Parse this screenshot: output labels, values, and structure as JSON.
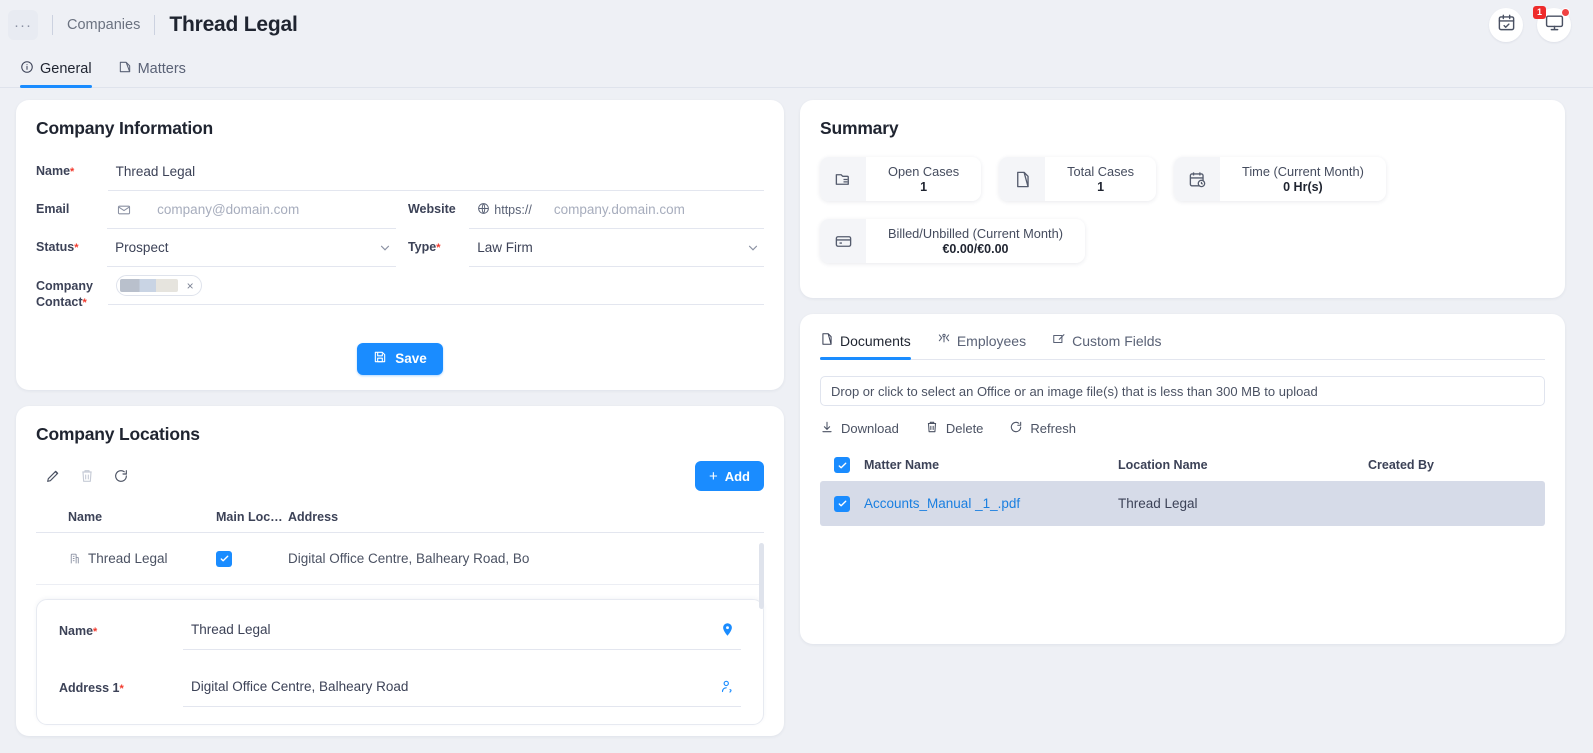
{
  "topbar": {
    "overflow_label": "···",
    "breadcrumb": "Companies",
    "title": "Thread Legal",
    "calendar_icon": "calendar-check-icon",
    "notification_icon": "monitor-notification-icon",
    "notification_count": "1"
  },
  "tabs": [
    {
      "label": "General",
      "icon": "info-circle-icon",
      "active": true
    },
    {
      "label": "Matters",
      "icon": "matters-icon",
      "active": false
    }
  ],
  "company_information": {
    "title": "Company Information",
    "fields": {
      "name": {
        "label": "Name",
        "required": true,
        "value": "Thread Legal"
      },
      "email": {
        "label": "Email",
        "required": false,
        "placeholder": "company@domain.com",
        "value": "",
        "icon": "envelope-icon"
      },
      "website": {
        "label": "Website",
        "required": false,
        "prefix": "https://",
        "placeholder": "company.domain.com",
        "value": "",
        "icon": "globe-icon"
      },
      "status": {
        "label": "Status",
        "required": true,
        "value": "Prospect"
      },
      "type": {
        "label": "Type",
        "required": true,
        "value": "Law Firm"
      },
      "company_contact": {
        "label": "Company Contact",
        "required": true,
        "chip_value": "",
        "chip_remove": "×"
      }
    },
    "save_label": "Save",
    "save_icon": "floppy-save-icon",
    "save_color": "#1a8cff"
  },
  "summary": {
    "title": "Summary",
    "stats": [
      {
        "label": "Open Cases",
        "value": "1",
        "icon": "folder-list-icon"
      },
      {
        "label": "Total Cases",
        "value": "1",
        "icon": "document-fold-icon"
      },
      {
        "label": "Time (Current Month)",
        "value": "0 Hr(s)",
        "icon": "calendar-clock-icon"
      },
      {
        "label": "Billed/Unbilled (Current Month)",
        "value": "€0.00/€0.00",
        "icon": "wallet-icon"
      }
    ]
  },
  "company_locations": {
    "title": "Company Locations",
    "toolbar": [
      {
        "name": "edit",
        "icon": "pencil-icon",
        "disabled": false
      },
      {
        "name": "delete",
        "icon": "trash-icon",
        "disabled": true
      },
      {
        "name": "refresh",
        "icon": "refresh-icon",
        "disabled": false
      }
    ],
    "add_label": "Add",
    "columns": [
      "Name",
      "Main Loc…",
      "Address"
    ],
    "rows": [
      {
        "name": "Thread Legal",
        "name_icon": "building-icon",
        "main_location": true,
        "address": "Digital Office Centre, Balheary Road, Bo"
      }
    ],
    "edit_form": {
      "name": {
        "label": "Name",
        "required": true,
        "value": "Thread Legal",
        "icon": "map-pin-icon"
      },
      "address1": {
        "label": "Address 1",
        "required": true,
        "value": "Digital Office Centre, Balheary Road",
        "icon": "person-search-icon"
      }
    }
  },
  "documents_panel": {
    "tabs": [
      {
        "label": "Documents",
        "icon": "document-fold-icon",
        "active": true
      },
      {
        "label": "Employees",
        "icon": "employees-icon",
        "active": false
      },
      {
        "label": "Custom Fields",
        "icon": "custom-fields-icon",
        "active": false
      }
    ],
    "dropzone_text": "Drop or click to select an Office or an image file(s) that is less than 300 MB to upload",
    "actions": [
      {
        "label": "Download",
        "icon": "download-icon"
      },
      {
        "label": "Delete",
        "icon": "trash-icon"
      },
      {
        "label": "Refresh",
        "icon": "refresh-icon"
      }
    ],
    "columns": [
      "Matter Name",
      "Location Name",
      "Created By"
    ],
    "select_all": true,
    "rows": [
      {
        "selected": true,
        "matter_name": "Accounts_Manual _1_.pdf",
        "location_name": "Thread Legal",
        "created_by": ""
      }
    ]
  },
  "theme": {
    "accent": "#1a8cff",
    "page_bg": "#eef0f5",
    "card_bg": "#ffffff",
    "required_mark": "#f2392c",
    "selected_row_bg": "#d6dbe8"
  }
}
